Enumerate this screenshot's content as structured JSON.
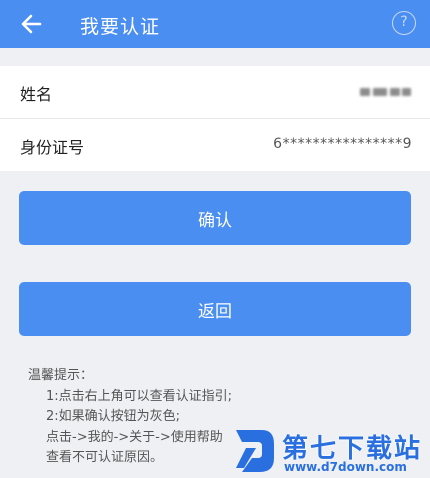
{
  "appbar": {
    "title": "我要认证",
    "back_icon": "back-arrow-icon",
    "help_icon": "question-mark-icon",
    "help_text": "?"
  },
  "form": {
    "name_label": "姓名",
    "id_label": "身份证号",
    "id_value": "6****************9"
  },
  "buttons": {
    "confirm": "确认",
    "back": "返回"
  },
  "tips": {
    "heading": "温馨提示：",
    "line1": "1:点击右上角可以查看认证指引;",
    "line2": "2:如果确认按钮为灰色;",
    "line3": "点击->我的->关于->使用帮助",
    "line4": "查看不可认证原因。"
  },
  "watermark": {
    "text": "第七下载站",
    "url": "www.d7down.com"
  },
  "colors": {
    "primary": "#4a8ef2",
    "background": "#eef0f4",
    "watermark": "#2a6fe0"
  }
}
